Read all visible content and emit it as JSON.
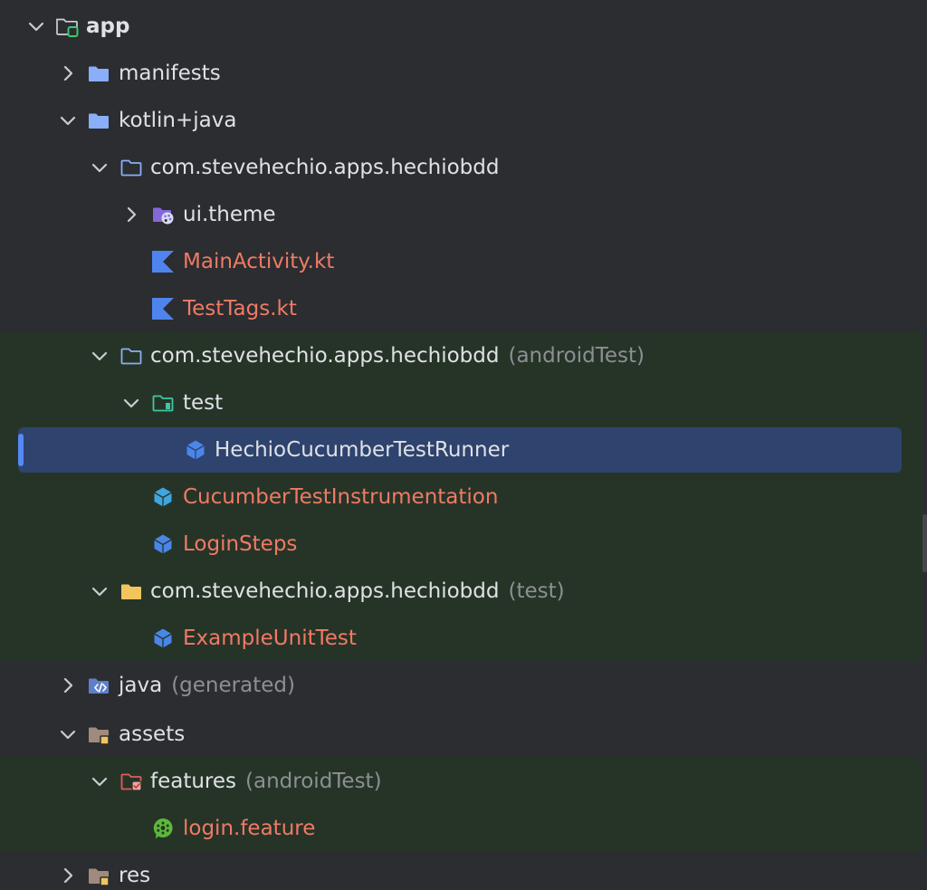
{
  "tree": {
    "app": {
      "label": "app"
    },
    "manifests": {
      "label": "manifests"
    },
    "kotlin_java": {
      "label": "kotlin+java"
    },
    "pkg_main": {
      "label": "com.stevehechio.apps.hechiobdd"
    },
    "ui_theme": {
      "label": "ui.theme"
    },
    "main_activity": {
      "label": "MainActivity.kt"
    },
    "test_tags": {
      "label": "TestTags.kt"
    },
    "pkg_android_test": {
      "label": "com.stevehechio.apps.hechiobdd",
      "suffix": "(androidTest)"
    },
    "test_folder": {
      "label": "test"
    },
    "test_runner": {
      "label": "HechioCucumberTestRunner"
    },
    "cucumber_instr": {
      "label": "CucumberTestInstrumentation"
    },
    "login_steps": {
      "label": "LoginSteps"
    },
    "pkg_test": {
      "label": "com.stevehechio.apps.hechiobdd",
      "suffix": "(test)"
    },
    "example_unit_test": {
      "label": "ExampleUnitTest"
    },
    "java_generated": {
      "label": "java",
      "suffix": "(generated)"
    },
    "assets": {
      "label": "assets"
    },
    "features": {
      "label": "features",
      "suffix": "(androidTest)"
    },
    "login_feature": {
      "label": "login.feature"
    },
    "res": {
      "label": "res"
    }
  },
  "colors": {
    "background": "#2b2d30",
    "test_scope_band": "#263427",
    "selection": "#2e436e",
    "selection_marker": "#548af7",
    "modified_file_text": "#f07a65",
    "default_text": "#dfe1e5",
    "scope_suffix_text": "#8c8f94"
  }
}
